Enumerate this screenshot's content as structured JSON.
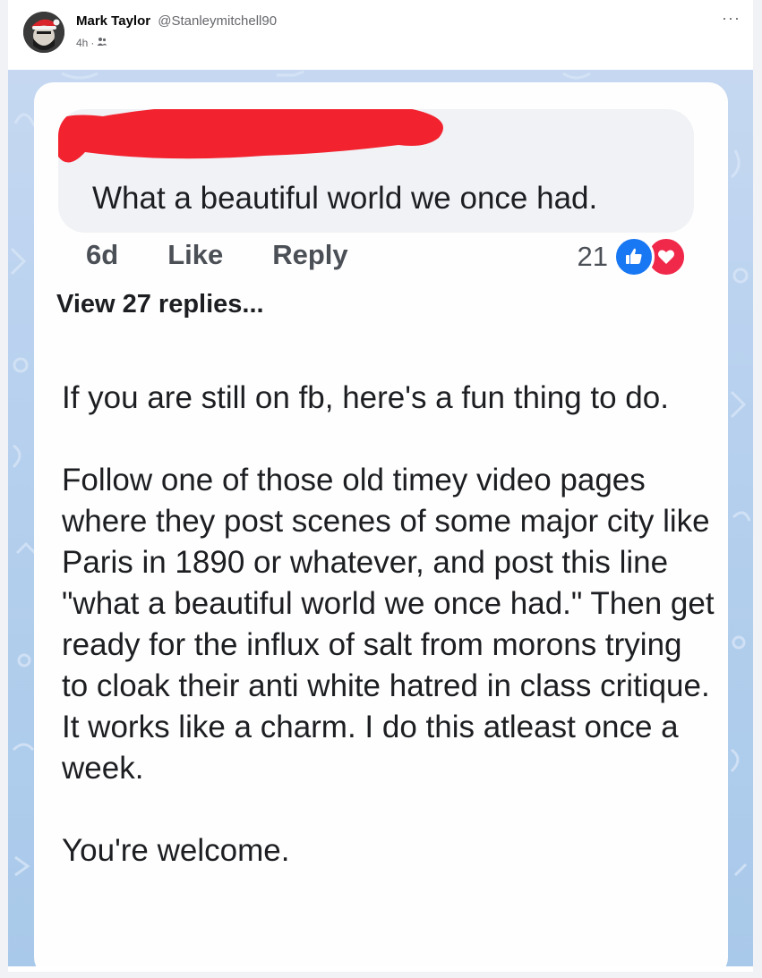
{
  "post": {
    "author_name": "Mark Taylor",
    "author_handle": "@Stanleymitchell90",
    "time": "4h",
    "separator": "·",
    "privacy_icon": "friends-icon",
    "more_label": "···"
  },
  "screenshot": {
    "comment_text": "What a beautiful world we once had.",
    "comment_age": "6d",
    "like_label": "Like",
    "reply_label": "Reply",
    "reaction_count": "21",
    "reaction_icons": [
      "like-icon",
      "love-icon"
    ],
    "view_replies": "View 27 replies...",
    "paragraphs": [
      "If you are still on fb, here's a fun thing to do.",
      "Follow one of those old timey video pages where they post scenes of some major city like Paris in 1890 or whatever, and post this line \"what a beautiful world we once had.\" Then get ready for the influx of salt from morons trying to cloak their anti white hatred in class critique. It works like a charm. I do this atleast once a week.",
      "You're welcome."
    ]
  },
  "colors": {
    "like_blue": "#1877f2",
    "love_red": "#f0284a",
    "redaction_red": "#f2222f",
    "image_bg": "#b6d0ee"
  }
}
